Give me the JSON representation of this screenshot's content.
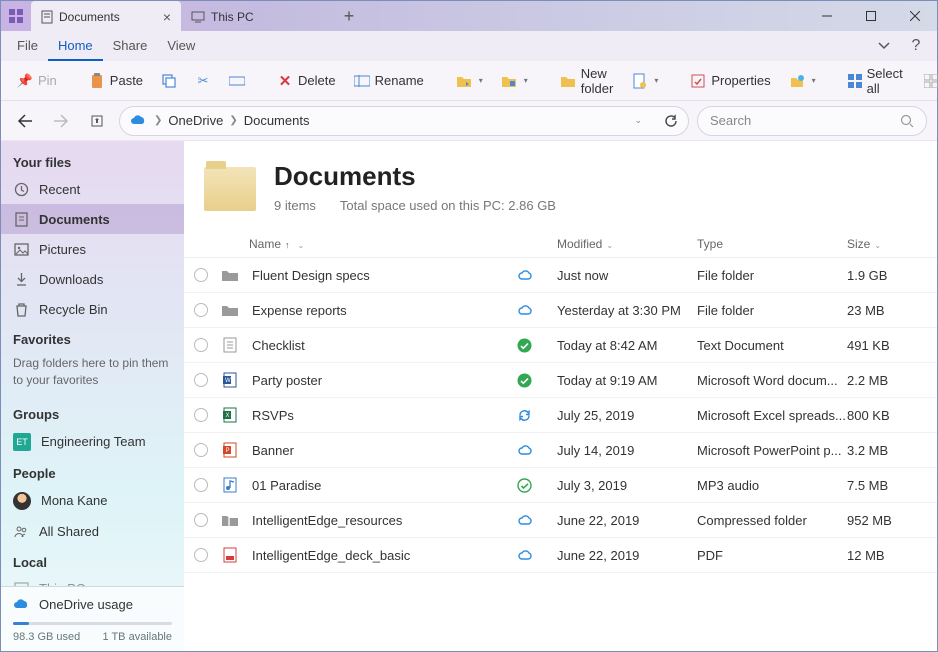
{
  "titlebar": {
    "tabs": [
      {
        "label": "Documents",
        "active": true,
        "icon": "document"
      },
      {
        "label": "This PC",
        "active": false,
        "icon": "pc"
      }
    ]
  },
  "menubar": {
    "items": [
      {
        "label": "File",
        "active": false
      },
      {
        "label": "Home",
        "active": true
      },
      {
        "label": "Share",
        "active": false
      },
      {
        "label": "View",
        "active": false
      }
    ]
  },
  "toolbar": {
    "pin": "Pin",
    "paste": "Paste",
    "delete": "Delete",
    "rename": "Rename",
    "newfolder": "New folder",
    "properties": "Properties",
    "selectall": "Select all"
  },
  "breadcrumb": {
    "items": [
      "OneDrive",
      "Documents"
    ]
  },
  "search": {
    "placeholder": "Search"
  },
  "sidebar": {
    "head_yourfiles": "Your files",
    "items_files": [
      {
        "label": "Recent",
        "icon": "recent"
      },
      {
        "label": "Documents",
        "icon": "documents",
        "active": true
      },
      {
        "label": "Pictures",
        "icon": "pictures"
      },
      {
        "label": "Downloads",
        "icon": "downloads"
      },
      {
        "label": "Recycle Bin",
        "icon": "recycle"
      }
    ],
    "head_favorites": "Favorites",
    "favorites_hint": "Drag folders here to pin them to your favorites",
    "head_groups": "Groups",
    "groups": [
      {
        "label": "Engineering Team",
        "badge": "ET",
        "color": "#1fa893"
      }
    ],
    "head_people": "People",
    "people": [
      {
        "label": "Mona Kane",
        "avatar": true
      },
      {
        "label": "All Shared",
        "icon": "shared"
      }
    ],
    "head_local": "Local",
    "local": [
      {
        "label": "This PC"
      }
    ],
    "footer": {
      "title": "OneDrive usage",
      "used": "98.3 GB used",
      "avail": "1 TB available",
      "percent": 10
    }
  },
  "header": {
    "title": "Documents",
    "count": "9 items",
    "space": "Total space used on this PC: 2.86 GB"
  },
  "columns": {
    "name": "Name",
    "modified": "Modified",
    "type": "Type",
    "size": "Size"
  },
  "rows": [
    {
      "name": "Fluent Design specs",
      "ftype": "folder",
      "status": "cloud",
      "mod": "Just now",
      "type": "File folder",
      "size": "1.9 GB"
    },
    {
      "name": "Expense reports",
      "ftype": "folder",
      "status": "cloud",
      "mod": "Yesterday at 3:30 PM",
      "type": "File folder",
      "size": "23 MB"
    },
    {
      "name": "Checklist",
      "ftype": "txt",
      "status": "check",
      "mod": "Today at 8:42 AM",
      "type": "Text Document",
      "size": "491 KB"
    },
    {
      "name": "Party poster",
      "ftype": "word",
      "status": "check",
      "mod": "Today at 9:19 AM",
      "type": "Microsoft Word docum...",
      "size": "2.2 MB"
    },
    {
      "name": "RSVPs",
      "ftype": "excel",
      "status": "sync",
      "mod": "July 25, 2019",
      "type": "Microsoft Excel spreads...",
      "size": "800 KB"
    },
    {
      "name": "Banner",
      "ftype": "ppt",
      "status": "cloud",
      "mod": "July 14, 2019",
      "type": "Microsoft PowerPoint p...",
      "size": "3.2 MB"
    },
    {
      "name": "01 Paradise",
      "ftype": "mp3",
      "status": "checkopen",
      "mod": "July 3, 2019",
      "type": "MP3 audio",
      "size": "7.5 MB"
    },
    {
      "name": "IntelligentEdge_resources",
      "ftype": "zip",
      "status": "cloud",
      "mod": "June 22, 2019",
      "type": "Compressed folder",
      "size": "952 MB"
    },
    {
      "name": "IntelligentEdge_deck_basic",
      "ftype": "pdf",
      "status": "cloud",
      "mod": "June 22, 2019",
      "type": "PDF",
      "size": "12 MB"
    }
  ]
}
